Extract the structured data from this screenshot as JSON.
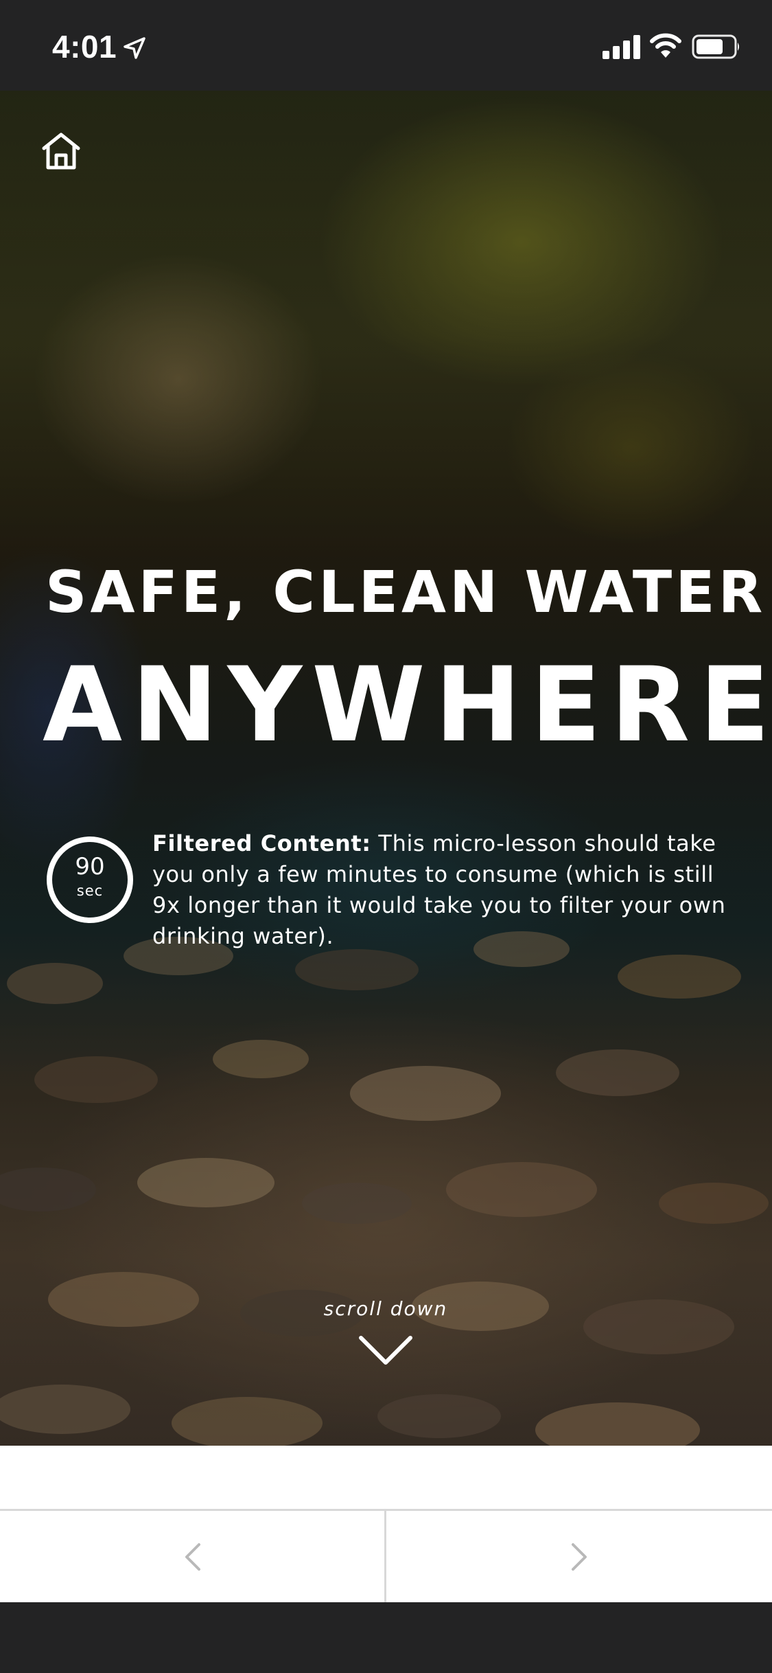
{
  "status_bar": {
    "time": "4:01",
    "icons": [
      "location-arrow-icon",
      "cellular-signal-icon",
      "wifi-icon",
      "battery-icon"
    ]
  },
  "hero": {
    "home_icon": "home-icon",
    "headline_top": "SAFE, CLEAN WATER",
    "headline_main": "ANYWHERE",
    "timer": {
      "value": "90",
      "unit": "sec"
    },
    "info": {
      "label": "Filtered Content:",
      "text": " This micro-lesson should take you only a few minutes to consume (which is still 9x longer than it would take you to filter your own drinking water)."
    },
    "scroll_hint": "scroll down",
    "scroll_icon": "chevron-down-icon"
  },
  "nav": {
    "prev_icon": "chevron-left-icon",
    "next_icon": "chevron-right-icon"
  },
  "colors": {
    "status_bar_bg": "#232324",
    "text": "#ffffff",
    "nav_bg": "#ffffff",
    "nav_divider": "#d8d8d8",
    "nav_arrow": "#b9b9b9"
  }
}
